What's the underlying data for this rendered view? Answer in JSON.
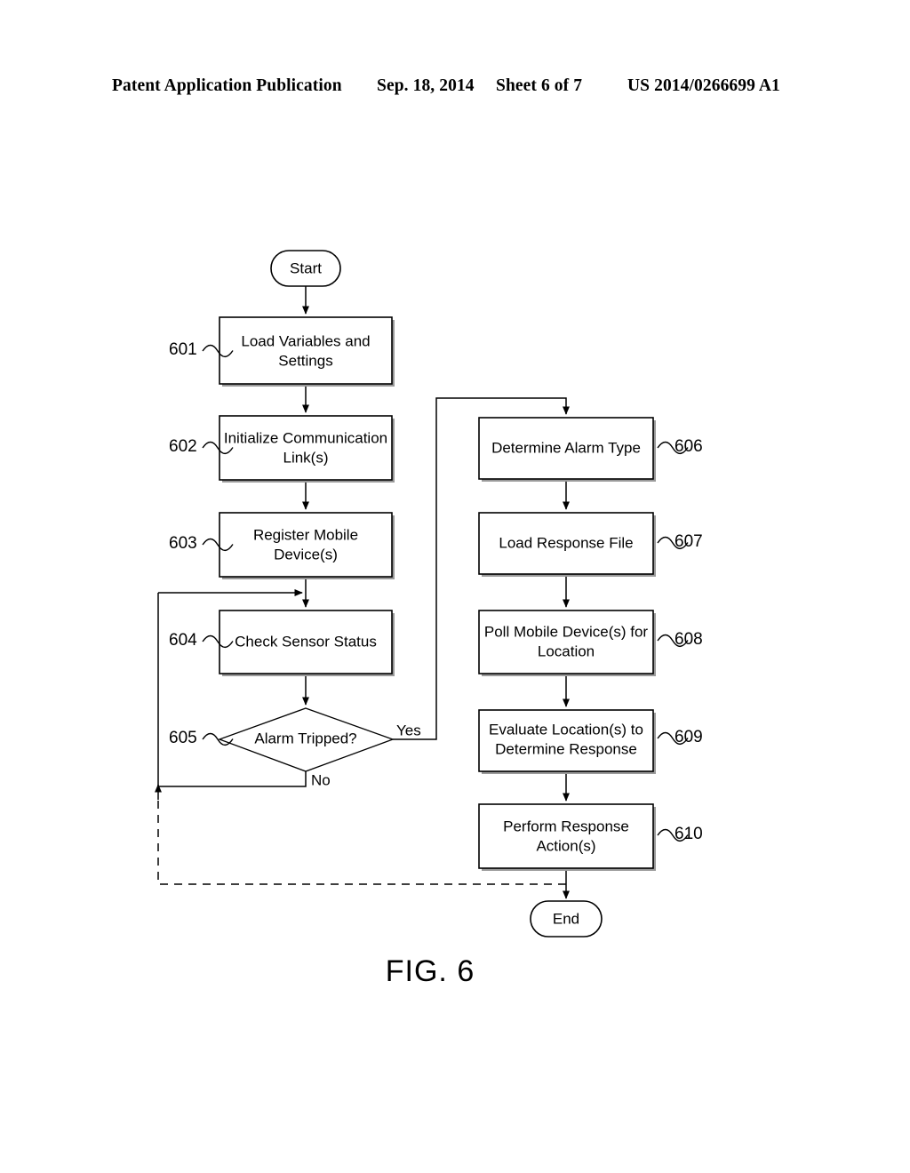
{
  "header": {
    "publication": "Patent Application Publication",
    "date": "Sep. 18, 2014",
    "sheet": "Sheet 6 of 7",
    "patent_number": "US 2014/0266699 A1"
  },
  "figure": {
    "caption": "FIG. 6",
    "terminators": {
      "start": "Start",
      "end": "End"
    },
    "branch_labels": {
      "yes": "Yes",
      "no": "No"
    },
    "nodes": [
      {
        "ref": "601",
        "label_line1": "Load Variables and",
        "label_line2": "Settings",
        "ref_side": "left"
      },
      {
        "ref": "602",
        "label_line1": "Initialize Communication",
        "label_line2": "Link(s)",
        "ref_side": "left"
      },
      {
        "ref": "603",
        "label_line1": "Register Mobile",
        "label_line2": "Device(s)",
        "ref_side": "left"
      },
      {
        "ref": "604",
        "label_line1": "Check Sensor Status",
        "label_line2": "",
        "ref_side": "left"
      },
      {
        "ref": "605",
        "label_line1": "Alarm Tripped?",
        "label_line2": "",
        "ref_side": "left"
      },
      {
        "ref": "606",
        "label_line1": "Determine Alarm Type",
        "label_line2": "",
        "ref_side": "right"
      },
      {
        "ref": "607",
        "label_line1": "Load Response File",
        "label_line2": "",
        "ref_side": "right"
      },
      {
        "ref": "608",
        "label_line1": "Poll Mobile Device(s) for",
        "label_line2": "Location",
        "ref_side": "right"
      },
      {
        "ref": "609",
        "label_line1": "Evaluate Location(s) to",
        "label_line2": "Determine Response",
        "ref_side": "right"
      },
      {
        "ref": "610",
        "label_line1": "Perform Response",
        "label_line2": "Action(s)",
        "ref_side": "right"
      }
    ]
  },
  "colors": {
    "ink": "#000000",
    "paper": "#ffffff",
    "shadow": "#9a9a9a"
  }
}
